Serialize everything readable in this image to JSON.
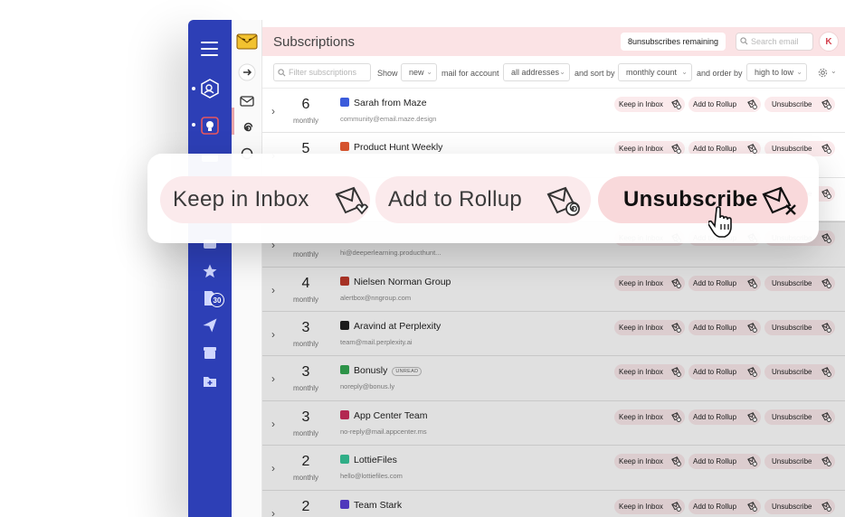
{
  "header": {
    "title": "Subscriptions",
    "remaining": "8unsubscribes remaining",
    "search_placeholder": "Search email",
    "avatar": "K"
  },
  "filters": {
    "search_placeholder": "Filter subscriptions",
    "show_label": "Show",
    "show_value": "new",
    "mail_label": "mail for account",
    "account_value": "all addresses",
    "sort_label": "and sort by",
    "sort_value": "monthly count",
    "order_label": "and order by",
    "order_value": "high to low"
  },
  "rail": {
    "badge_count": "30"
  },
  "actions": {
    "keep": "Keep in Inbox",
    "rollup": "Add to Rollup",
    "unsubscribe": "Unsubscribe"
  },
  "big_actions": {
    "keep": "Keep in Inbox",
    "rollup": "Add to Rollup",
    "unsubscribe": "Unsubscribe"
  },
  "rows": [
    {
      "count": "6",
      "period": "monthly",
      "name": "Sarah from Maze",
      "email": "community@email.maze.design",
      "logo_color": "#3b5bdb"
    },
    {
      "count": "5",
      "period": "",
      "name": "Product Hunt Weekly",
      "email": "",
      "logo_color": "#da552f"
    },
    {
      "count": "",
      "period": "",
      "name": "",
      "email": "",
      "logo_color": "#ffffff"
    },
    {
      "count": "",
      "period": "monthly",
      "name": "",
      "email": "hi@deeperlearning.producthunt...",
      "logo_color": "#ffffff"
    },
    {
      "count": "4",
      "period": "monthly",
      "name": "Nielsen Norman Group",
      "email": "alertbox@nngroup.com",
      "logo_color": "#c0392b"
    },
    {
      "count": "3",
      "period": "monthly",
      "name": "Aravind at Perplexity",
      "email": "team@mail.perplexity.ai",
      "logo_color": "#222222"
    },
    {
      "count": "3",
      "period": "monthly",
      "name": "Bonusly",
      "email": "noreply@bonus.ly",
      "logo_color": "#34a853",
      "unread": "UNREAD"
    },
    {
      "count": "3",
      "period": "monthly",
      "name": "App Center Team",
      "email": "no-reply@mail.appcenter.ms",
      "logo_color": "#cc2e5d"
    },
    {
      "count": "2",
      "period": "monthly",
      "name": "LottieFiles",
      "email": "hello@lottiefiles.com",
      "logo_color": "#37c79a"
    },
    {
      "count": "2",
      "period": "",
      "name": "Team Stark",
      "email": "",
      "logo_color": "#5b3fd6"
    }
  ]
}
